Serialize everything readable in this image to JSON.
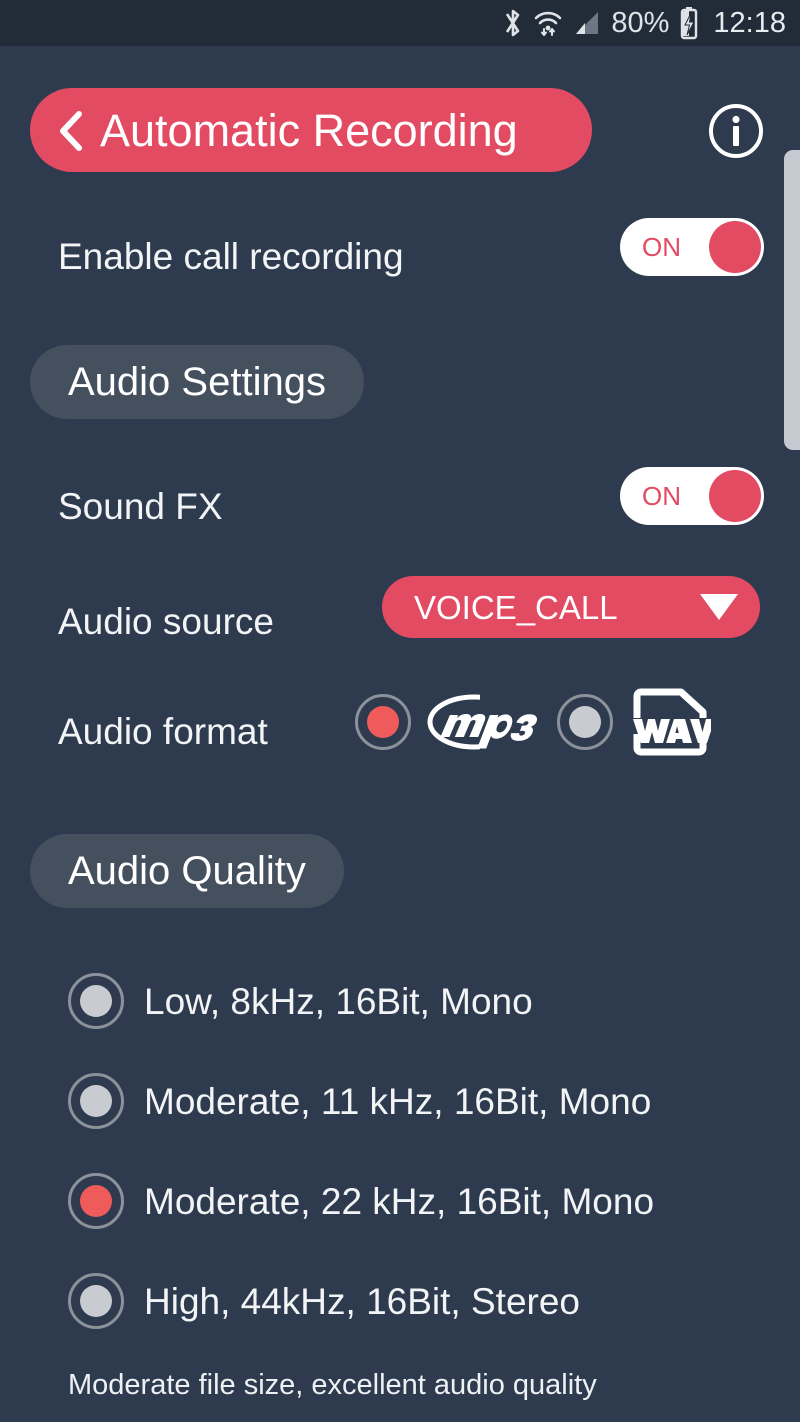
{
  "statusbar": {
    "icons": [
      "bluetooth-icon",
      "wifi-icon",
      "cellular-signal-icon",
      "battery-charging-icon"
    ],
    "battery_percent": "80%",
    "time": "12:18"
  },
  "header": {
    "back_icon": "chevron-left-icon",
    "title": "Automatic Recording",
    "info_icon": "info-icon",
    "pill_color": "#e34b63"
  },
  "settings": {
    "enable_call_recording": {
      "label": "Enable call recording",
      "toggle_state": "ON"
    }
  },
  "audio_settings": {
    "section_title": "Audio Settings",
    "sound_fx": {
      "label": "Sound FX",
      "toggle_state": "ON"
    },
    "audio_source": {
      "label": "Audio source",
      "value": "VOICE_CALL",
      "caret_icon": "chevron-down-icon"
    },
    "audio_format": {
      "label": "Audio format",
      "options": [
        {
          "name": "mp3",
          "icon": "mp3-logo-icon",
          "selected": true
        },
        {
          "name": "wav",
          "icon": "wav-file-icon",
          "selected": false
        }
      ]
    }
  },
  "audio_quality": {
    "section_title": "Audio Quality",
    "options": [
      {
        "label": "Low, 8kHz, 16Bit, Mono",
        "selected": false
      },
      {
        "label": "Moderate, 11 kHz, 16Bit, Mono",
        "selected": false
      },
      {
        "label": "Moderate, 22 kHz, 16Bit, Mono",
        "selected": true
      },
      {
        "label": "High, 44kHz, 16Bit, Stereo",
        "selected": false
      }
    ],
    "caption": "Moderate file size, excellent audio quality"
  },
  "colors": {
    "background": "#2e3b4e",
    "statusbar_bg": "#222c38",
    "accent": "#e34b63",
    "section_pill": "#45505f",
    "radio_selected": "#ef5a5a",
    "radio_unselected": "#c8cbd0"
  }
}
